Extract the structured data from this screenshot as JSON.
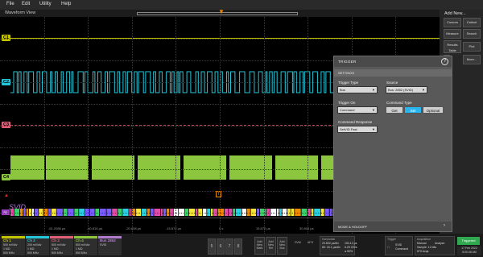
{
  "menu": [
    "File",
    "Edit",
    "Utility",
    "Help"
  ],
  "waveform_view": {
    "title": "Waveform View",
    "ch1_marker": "C1",
    "ch2_marker": "C2",
    "ch3_marker": "C3",
    "ch4_marker": "C4",
    "bus_marker": "B1",
    "bus_label": "SVID",
    "trigger_marker": "T",
    "x_ticks": [
      "-61.2086 µs",
      "-40.816 µs",
      "-20.808 µs",
      "-15.672 µs",
      "0 s",
      "15.672 µs",
      "30.808 µs",
      "60.6808 µs"
    ]
  },
  "right_panel": {
    "title": "Add New...",
    "buttons": [
      "Cursors",
      "Callout",
      "Measure",
      "Search",
      "Results Table",
      "Plot",
      "More..."
    ]
  },
  "trigger_panel": {
    "title": "TRIGGER",
    "help": "?",
    "settings_label": "SETTINGS",
    "trigger_type_label": "Trigger Type",
    "trigger_type_value": "Bus",
    "source_label": "Source",
    "source_value": "Bus: 2852 (SVID)",
    "trigger_on_label": "Trigger On",
    "trigger_on_value": "Command",
    "command_type_label": "Command Type",
    "command_type_options": [
      "Get",
      "Set",
      "Optional"
    ],
    "command_type_selected": "Set",
    "command_response_label": "Command Response",
    "command_response_value": "SetVID Fast",
    "mode_label": "MODE & HOLDOFF"
  },
  "bottom_bar": {
    "channels": [
      {
        "name": "Ch 1",
        "color": "#c4c400",
        "lines": [
          "500 mV/div",
          "1 MΩ",
          "500 MHz"
        ]
      },
      {
        "name": "Ch 2",
        "color": "#26c6da",
        "lines": [
          "200 mV/div",
          "1 MΩ",
          "500 MHz"
        ]
      },
      {
        "name": "Ch 3",
        "color": "#e0607a",
        "lines": [
          "500 mV/div",
          "1 MΩ",
          "500 MHz"
        ]
      },
      {
        "name": "Ch 4",
        "color": "#8cc63f",
        "lines": [
          "500 mV/div",
          "1 MΩ",
          "500 MHz"
        ]
      },
      {
        "name": "Bus 2852",
        "color": "#b07cd0",
        "lines": [
          "SVID",
          "",
          ""
        ]
      }
    ],
    "channel_numbers": [
      "5",
      "6",
      "7",
      "8"
    ],
    "add_buttons": [
      "Add New Math",
      "Add New Ref",
      "Add New Bus"
    ],
    "small_buttons": [
      "DVM",
      "AFG"
    ],
    "horizontal": {
      "header": "Horizontal",
      "lines": [
        "20.832 µs/div",
        "80: 16.1 µs/div",
        "154.12 µs",
        "6.25 GS/s",
        "● 50%"
      ]
    },
    "trigger": {
      "header": "Trigger",
      "lines": [
        "SVID",
        "Command"
      ]
    },
    "acquisition": {
      "header": "Acquisition",
      "lines": [
        "Manual",
        "Analyze",
        "Sample: 12 bits",
        "870 Acqs"
      ]
    },
    "triggered": "Triggered",
    "date": "17 Feb 2022",
    "time": "5:00:46 AM"
  },
  "colors": {
    "ch1": "#c4c400",
    "ch2": "#26c6da",
    "ch3": "#e0607a",
    "ch4": "#8cc63f",
    "bus": "#b07cd0",
    "accent": "#29b6ee",
    "triggered": "#2fa84f",
    "trigger_marker": "#f08a00"
  }
}
